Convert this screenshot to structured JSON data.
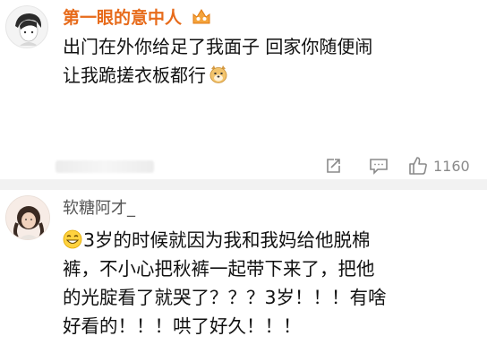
{
  "comments": [
    {
      "username": "第一眼的意中人",
      "text_lines": [
        "出门在外你给足了我面子 回家你随便闹",
        "让我跪搓衣板都行"
      ],
      "actions": {
        "like_count": "1160"
      },
      "colors": {
        "username": "#e76b1b"
      }
    },
    {
      "username": "软糖阿才_",
      "text_lines": [
        "3岁的时候就因为我和我妈给他脱棉",
        "裤，不小心把秋裤一起带下来了，把他",
        "的光腚看了就哭了？？？3岁！！！有啥",
        "好看的！！！哄了好久！！！"
      ]
    }
  ]
}
